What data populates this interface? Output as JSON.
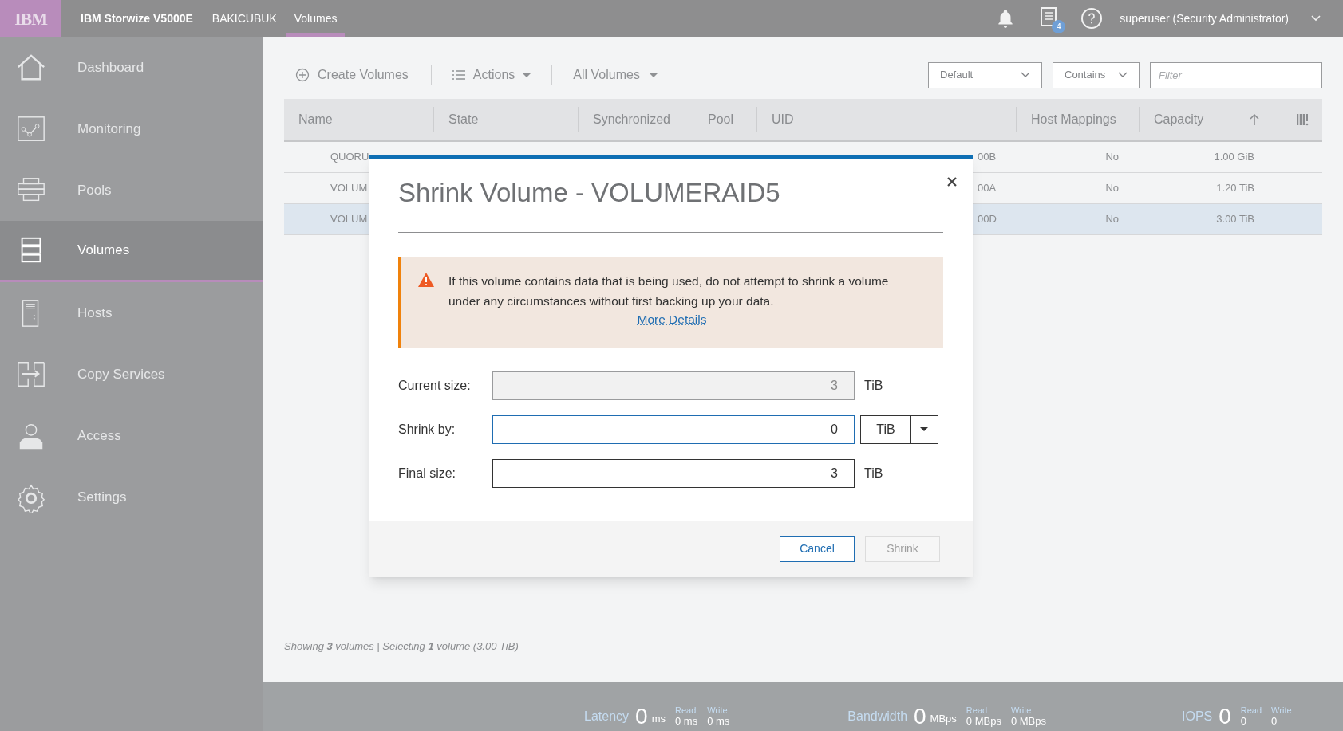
{
  "topbar": {
    "brand": "IBM",
    "product": "IBM Storwize V5000E",
    "system": "BAKICUBUK",
    "tabs": [
      {
        "label": "Volumes",
        "selected": true
      }
    ],
    "notification_count": "4",
    "user": "superuser (Security Administrator)"
  },
  "sidebar": {
    "items": [
      {
        "label": "Dashboard",
        "selected": false
      },
      {
        "label": "Monitoring",
        "selected": false
      },
      {
        "label": "Pools",
        "selected": false
      },
      {
        "label": "Volumes",
        "selected": true
      },
      {
        "label": "Hosts",
        "selected": false
      },
      {
        "label": "Copy Services",
        "selected": false
      },
      {
        "label": "Access",
        "selected": false
      },
      {
        "label": "Settings",
        "selected": false
      }
    ]
  },
  "toolbar": {
    "create": "Create Volumes",
    "actions": "Actions",
    "view": "All Volumes",
    "selects": [
      "Default",
      "Contains"
    ],
    "filter_placeholder": "Filter"
  },
  "table": {
    "columns": [
      {
        "label": "Name",
        "sorted": false
      },
      {
        "label": "State",
        "sorted": false
      },
      {
        "label": "Synchronized",
        "sorted": false
      },
      {
        "label": "Pool",
        "sorted": false
      },
      {
        "label": "UID",
        "sorted": false
      },
      {
        "label": "Host Mappings",
        "sorted": false
      },
      {
        "label": "Capacity",
        "sorted": true
      }
    ],
    "rows": [
      {
        "name": "QUORU",
        "uid": "00B",
        "host_mappings": "No",
        "capacity": "1.00 GiB",
        "selected": false
      },
      {
        "name": "VOLUM",
        "uid": "00A",
        "host_mappings": "No",
        "capacity": "1.20 TiB",
        "selected": false
      },
      {
        "name": "VOLUM",
        "uid": "00D",
        "host_mappings": "No",
        "capacity": "3.00 TiB",
        "selected": true
      }
    ]
  },
  "status": "Showing **3** volumes | Selecting **1** volume (3.00 TiB)",
  "dialog": {
    "title": "Shrink Volume - VOLUMERAID5",
    "warning": "If this volume contains data that is being used, do not attempt to shrink a volume under any circumstances without first backing up your data.",
    "link": "More Details",
    "fields": [
      {
        "label": "Current size:",
        "value": "3",
        "unit": "TiB",
        "kind": "readonly"
      },
      {
        "label": "Shrink by:",
        "value": "0",
        "unit": "TiB",
        "kind": "select"
      },
      {
        "label": "Final size:",
        "value": "3",
        "unit": "TiB",
        "kind": "plain"
      }
    ],
    "buttons": [
      {
        "label": "Cancel",
        "disabled": false
      },
      {
        "label": "Shrink",
        "disabled": true
      }
    ]
  },
  "performance": [
    {
      "label": "Latency",
      "value": "0",
      "unit": "ms",
      "read_label": "Read",
      "read": "0 ms",
      "write_label": "Write",
      "write": "0 ms"
    },
    {
      "label": "Bandwidth",
      "value": "0",
      "unit": "MBps",
      "read_label": "Read",
      "read": "0 MBps",
      "write_label": "Write",
      "write": "0 MBps"
    },
    {
      "label": "IOPS",
      "value": "0",
      "read_label": "Read",
      "read": "0",
      "write_label": "Write",
      "write": "0"
    }
  ]
}
